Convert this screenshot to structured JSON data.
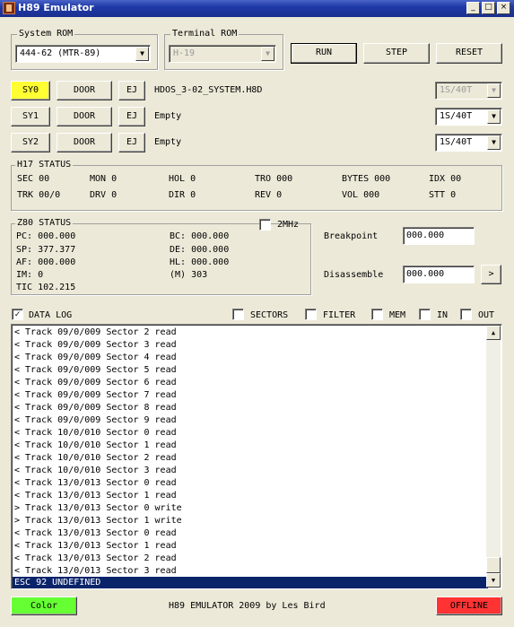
{
  "window": {
    "title": "H89 Emulator",
    "minimize_glyph": "_",
    "maximize_glyph": "□",
    "close_glyph": "×"
  },
  "system_rom": {
    "label": "System ROM",
    "value": "444-62 (MTR-89)"
  },
  "terminal_rom": {
    "label": "Terminal ROM",
    "value": "H-19"
  },
  "controls": {
    "run": "RUN",
    "step": "STEP",
    "reset": "RESET"
  },
  "drives": [
    {
      "name": "SY0",
      "door": "DOOR",
      "eject": "EJ",
      "image": "HDOS_3-02_SYSTEM.H8D",
      "format": "1S/40T",
      "format_enabled": false
    },
    {
      "name": "SY1",
      "door": "DOOR",
      "eject": "EJ",
      "image": "Empty",
      "format": "1S/40T",
      "format_enabled": true
    },
    {
      "name": "SY2",
      "door": "DOOR",
      "eject": "EJ",
      "image": "Empty",
      "format": "1S/40T",
      "format_enabled": true
    }
  ],
  "h17_status": {
    "label": "H17 STATUS",
    "row1": [
      "SEC 00",
      "MON 0",
      "HOL 0",
      "TRO 000",
      "BYTES 000",
      "IDX 00"
    ],
    "row2": [
      "TRK 00/0",
      "DRV 0",
      "DIR 0",
      "REV 0",
      "VOL 000",
      "STT 0"
    ]
  },
  "z80_status": {
    "label": "Z80 STATUS",
    "mhz_label": "2MHz",
    "mhz_checked": false,
    "left": [
      "PC: 000.000",
      "SP: 377.377",
      "AF: 000.000",
      "IM: 0",
      "TIC 102.215"
    ],
    "right": [
      "BC: 000.000",
      "DE: 000.000",
      "HL: 000.000",
      "(M) 303"
    ]
  },
  "breakpoint": {
    "label": "Breakpoint",
    "value": "000.000"
  },
  "disassemble": {
    "label": "Disassemble",
    "value": "000.000",
    "go": ">"
  },
  "log_options": {
    "data_log": {
      "label": "DATA LOG",
      "checked": true,
      "mark": "✓"
    },
    "sectors": {
      "label": "SECTORS",
      "checked": false
    },
    "filter": {
      "label": "FILTER",
      "checked": false
    },
    "mem": {
      "label": "MEM",
      "checked": false
    },
    "in": {
      "label": "IN",
      "checked": false
    },
    "out": {
      "label": "OUT",
      "checked": false
    }
  },
  "log_lines": [
    "< Track 09/0/009 Sector 2 read",
    "< Track 09/0/009 Sector 3 read",
    "< Track 09/0/009 Sector 4 read",
    "< Track 09/0/009 Sector 5 read",
    "< Track 09/0/009 Sector 6 read",
    "< Track 09/0/009 Sector 7 read",
    "< Track 09/0/009 Sector 8 read",
    "< Track 09/0/009 Sector 9 read",
    "< Track 10/0/010 Sector 0 read",
    "< Track 10/0/010 Sector 1 read",
    "< Track 10/0/010 Sector 2 read",
    "< Track 10/0/010 Sector 3 read",
    "< Track 13/0/013 Sector 0 read",
    "< Track 13/0/013 Sector 1 read",
    "> Track 13/0/013 Sector 0 write",
    "> Track 13/0/013 Sector 1 write",
    "< Track 13/0/013 Sector 0 read",
    "< Track 13/0/013 Sector 1 read",
    "< Track 13/0/013 Sector 2 read",
    "< Track 13/0/013 Sector 3 read"
  ],
  "log_selected": "ESC 92 UNDEFINED",
  "scroll": {
    "up": "▲",
    "down": "▼"
  },
  "footer": {
    "color_button": "Color",
    "credit": "H89 EMULATOR 2009 by Les Bird",
    "offline_button": "OFFLINE"
  },
  "arrow_glyph": "▼",
  "colors": {
    "title_bar": "#1f3aa6",
    "sy0_active": "#ffff33",
    "color_button": "#66ff33",
    "offline_button": "#ff3333",
    "selection": "#0a246a"
  }
}
